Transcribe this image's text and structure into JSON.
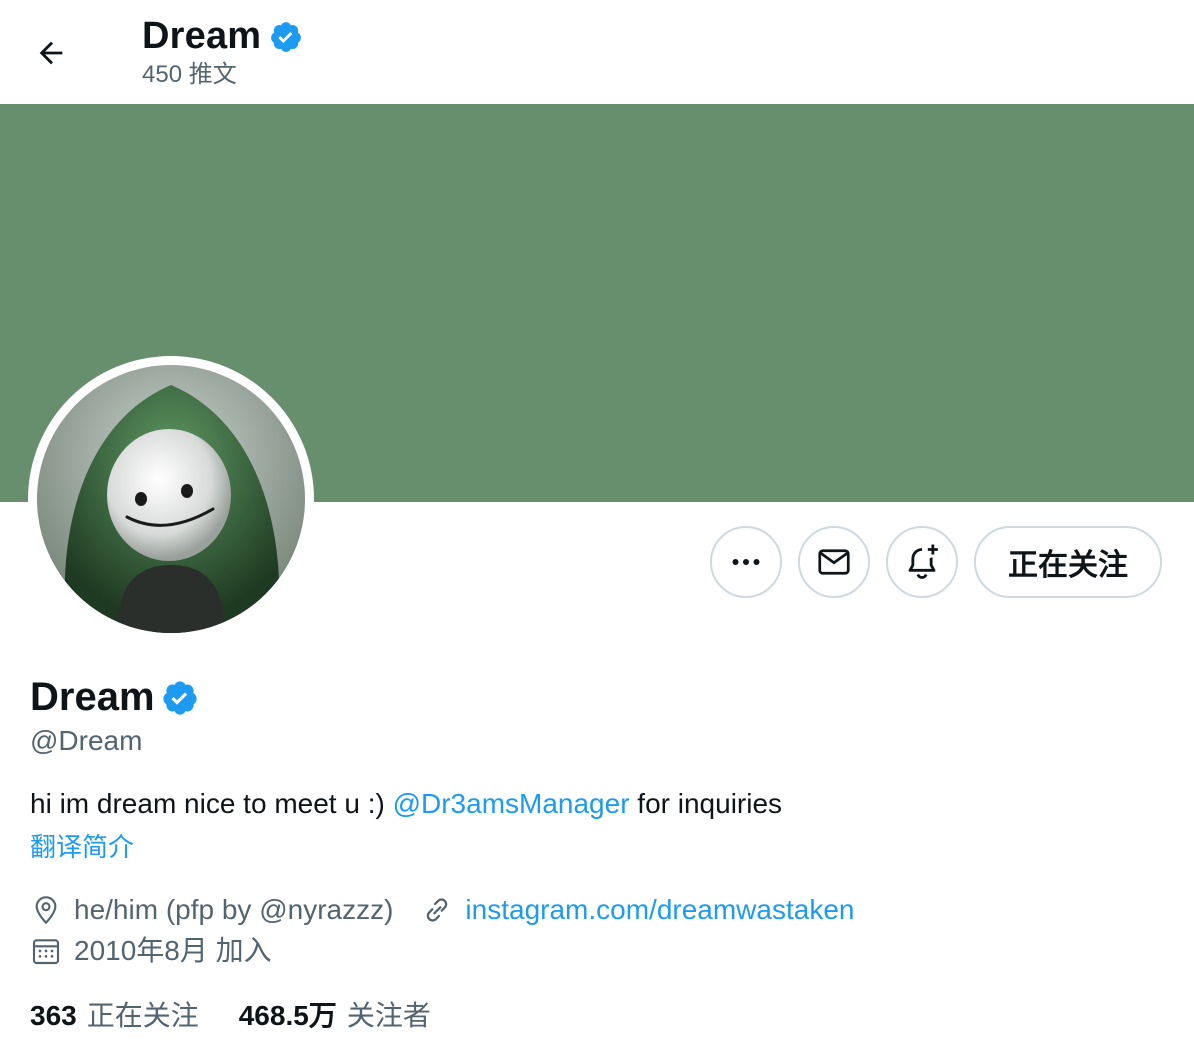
{
  "colors": {
    "banner": "#678e6d",
    "accent": "#1d9bf0",
    "text_primary": "#0f1419",
    "text_secondary": "#536471",
    "border": "#cfd9de"
  },
  "header": {
    "back_icon": "arrow-left-icon",
    "title": "Dream",
    "verified_icon": "verified-badge-icon",
    "tweet_count": "450 推文"
  },
  "profile": {
    "avatar_icon": "avatar-image",
    "name": "Dream",
    "handle": "@Dream",
    "bio_text": "hi im dream nice to meet u :) ",
    "bio_mention": "@Dr3amsManager",
    "bio_suffix": " for inquiries",
    "translate_label": "翻译简介",
    "location": "he/him (pfp by @nyrazzz)",
    "link": "instagram.com/dreamwastaken",
    "joined": "2010年8月 加入"
  },
  "actions": {
    "more_icon": "more-icon",
    "message_icon": "mail-icon",
    "notify_icon": "bell-plus-icon",
    "follow_label": "正在关注"
  },
  "stats": {
    "following_count": "363",
    "following_label": "正在关注",
    "followers_count": "468.5万",
    "followers_label": "关注者"
  }
}
